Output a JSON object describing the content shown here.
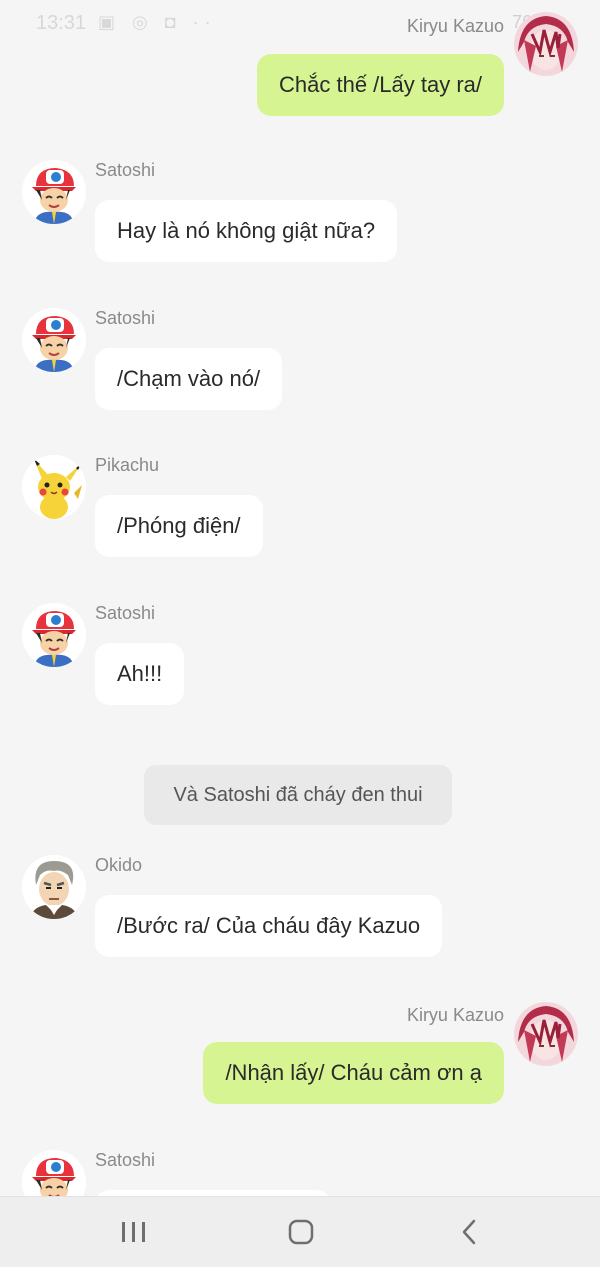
{
  "status_bar": {
    "time": "13:31",
    "battery": "76%"
  },
  "messages": [
    {
      "side": "right",
      "sender": "Kiryu Kazuo",
      "text": "Chắc thế /Lấy tay ra/",
      "avatar": "red-haired-character-avatar"
    },
    {
      "side": "left",
      "sender": "Satoshi",
      "text": "Hay là nó không giật nữa?",
      "avatar": "satoshi-avatar"
    },
    {
      "side": "left",
      "sender": "Satoshi",
      "text": "/Chạm vào nó/",
      "avatar": "satoshi-avatar"
    },
    {
      "side": "left",
      "sender": "Pikachu",
      "text": "/Phóng điện/",
      "avatar": "pikachu-avatar"
    },
    {
      "side": "left",
      "sender": "Satoshi",
      "text": "Ah!!!",
      "avatar": "satoshi-avatar"
    },
    {
      "side": "left",
      "sender": "Okido",
      "text": "/Bước ra/ Của cháu đây Kazuo",
      "avatar": "okido-avatar"
    },
    {
      "side": "right",
      "sender": "Kiryu Kazuo",
      "text": "/Nhận lấy/ Cháu cảm ơn ạ",
      "avatar": "red-haired-character-avatar"
    },
    {
      "side": "left",
      "sender": "Satoshi",
      "text": "",
      "avatar": "satoshi-avatar"
    }
  ],
  "system_message": "Và Satoshi đã cháy đen thui",
  "colors": {
    "background": "#f5f5f5",
    "outgoing_bubble": "#d6f592",
    "incoming_bubble": "#ffffff",
    "system_bubble": "#e9e9e9",
    "sender_name": "#8a8a8a"
  },
  "nav_bar": {
    "recent_icon": "recent-apps-icon",
    "home_icon": "home-icon",
    "back_icon": "back-icon"
  }
}
